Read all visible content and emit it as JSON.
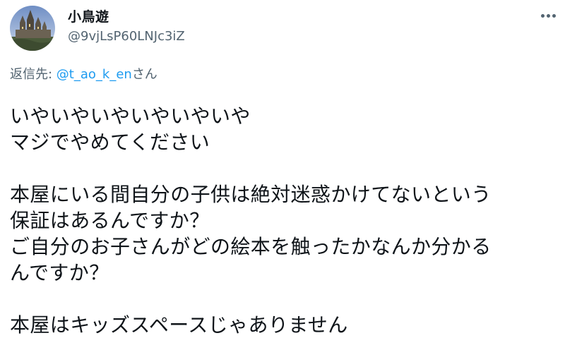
{
  "user": {
    "display_name": "小鳥遊",
    "handle": "@9vjLsP60LNJc3iZ",
    "avatar": "castle-avatar-image"
  },
  "menu": {
    "icon": "more-horizontal-icon"
  },
  "reply": {
    "prefix": "返信先: ",
    "mention": "@t_ao_k_en",
    "suffix": "さん"
  },
  "body": {
    "lines": [
      "いやいやいやいやいやいや",
      "マジでやめてください",
      "",
      "本屋にいる間自分の子供は絶対迷惑かけてないという",
      "保証はあるんですか？",
      "ご自分のお子さんがどの絵本を触ったかなんか分かる",
      "んですか？",
      "",
      "本屋はキッズスペースじゃありません"
    ]
  },
  "colors": {
    "text": "#0f1419",
    "secondary": "#536471",
    "link": "#1d9bf0"
  }
}
